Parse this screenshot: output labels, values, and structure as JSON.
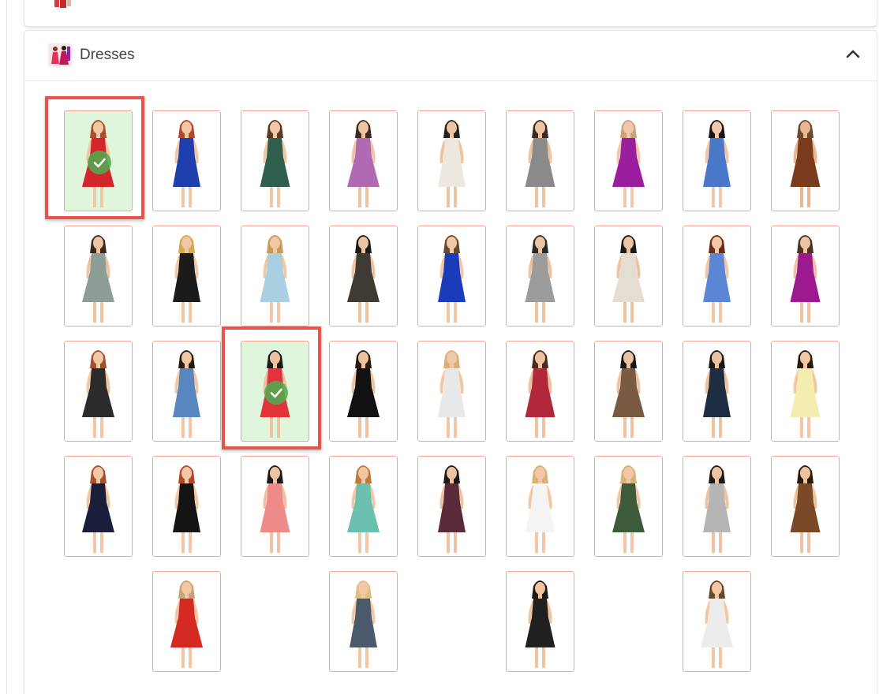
{
  "section": {
    "title": "Dresses",
    "icon": "dresses-category-icon",
    "chevron_icon": "chevron-up-icon"
  },
  "previous_section": {
    "icon": "category-thumbnail-icon"
  },
  "dresses": [
    {
      "dress": "#d3262a",
      "skin": "#f2c7a5",
      "hair": "#a8512c",
      "selected": true
    },
    {
      "dress": "#1f3fb0",
      "skin": "#f2c7a5",
      "hair": "#b4472a",
      "selected": false
    },
    {
      "dress": "#2f5e4c",
      "skin": "#f2c7a5",
      "hair": "#5a3a24",
      "selected": false
    },
    {
      "dress": "#b06ab4",
      "skin": "#eec3a2",
      "hair": "#3b2a20",
      "selected": false
    },
    {
      "dress": "#ece7df",
      "skin": "#eec3a2",
      "hair": "#222222",
      "selected": false
    },
    {
      "dress": "#8a8a8a",
      "skin": "#eec3a2",
      "hair": "#3b2a20",
      "selected": false
    },
    {
      "dress": "#9b1e9e",
      "skin": "#f1c9aa",
      "hair": "#c9a47a",
      "selected": false
    },
    {
      "dress": "#4a78c8",
      "skin": "#f1c9aa",
      "hair": "#151515",
      "selected": false
    },
    {
      "dress": "#7a3b1c",
      "skin": "#e8b690",
      "hair": "#6a4a2c",
      "selected": false
    },
    {
      "dress": "#8d9e96",
      "skin": "#eec3a2",
      "hair": "#3b2a20",
      "selected": false
    },
    {
      "dress": "#1b1b1b",
      "skin": "#f2c7a5",
      "hair": "#d6a84a",
      "selected": false
    },
    {
      "dress": "#a9cfe0",
      "skin": "#f2c7a5",
      "hair": "#c89a5a",
      "selected": false
    },
    {
      "dress": "#3e3a34",
      "skin": "#eec3a2",
      "hair": "#1a1a1a",
      "selected": false
    },
    {
      "dress": "#1a3cba",
      "skin": "#f2c7a5",
      "hair": "#6a4a2c",
      "selected": false
    },
    {
      "dress": "#9c9c9c",
      "skin": "#eec3a2",
      "hair": "#2a2a2a",
      "selected": false
    },
    {
      "dress": "#e4ddd2",
      "skin": "#eec3a2",
      "hair": "#1a1a1a",
      "selected": false
    },
    {
      "dress": "#5b86d6",
      "skin": "#f2c7a5",
      "hair": "#6a2a1a",
      "selected": false
    },
    {
      "dress": "#9c1a8e",
      "skin": "#eec3a2",
      "hair": "#4a3322",
      "selected": false
    },
    {
      "dress": "#2b2b2b",
      "skin": "#f2c7a5",
      "hair": "#a0522d",
      "selected": false
    },
    {
      "dress": "#5a86c0",
      "skin": "#f2c7a5",
      "hair": "#2a1a10",
      "selected": false
    },
    {
      "dress": "#e0343a",
      "skin": "#eec3a2",
      "hair": "#1a1a1a",
      "selected": true
    },
    {
      "dress": "#111111",
      "skin": "#eec3a2",
      "hair": "#2a1a10",
      "selected": false
    },
    {
      "dress": "#e8e8e8",
      "skin": "#f2c7a5",
      "hair": "#d9b27a",
      "selected": false
    },
    {
      "dress": "#b0283a",
      "skin": "#eec3a2",
      "hair": "#4a2a1a",
      "selected": false
    },
    {
      "dress": "#7a5a42",
      "skin": "#eec3a2",
      "hair": "#1a1a1a",
      "selected": false
    },
    {
      "dress": "#1e2e40",
      "skin": "#eec3a2",
      "hair": "#1a1a1a",
      "selected": false
    },
    {
      "dress": "#f3eeb0",
      "skin": "#f2c7a5",
      "hair": "#2a1a10",
      "selected": false
    },
    {
      "dress": "#1a1e3a",
      "skin": "#f2c7a5",
      "hair": "#a8512c",
      "selected": false
    },
    {
      "dress": "#141414",
      "skin": "#f2c7a5",
      "hair": "#b4472a",
      "selected": false
    },
    {
      "dress": "#ee8a8a",
      "skin": "#eec3a2",
      "hair": "#1a1a1a",
      "selected": false
    },
    {
      "dress": "#6cc0b0",
      "skin": "#f2c7a5",
      "hair": "#c07a3a",
      "selected": false
    },
    {
      "dress": "#5a2a3a",
      "skin": "#eec3a2",
      "hair": "#1a1a1a",
      "selected": false
    },
    {
      "dress": "#f4f4f4",
      "skin": "#f2c7a5",
      "hair": "#d9b27a",
      "selected": false
    },
    {
      "dress": "#3d5a3a",
      "skin": "#f2c7a5",
      "hair": "#d9b27a",
      "selected": false
    },
    {
      "dress": "#b5b5b5",
      "skin": "#eec3a2",
      "hair": "#1a1a1a",
      "selected": false
    },
    {
      "dress": "#7a4a28",
      "skin": "#eec3a2",
      "hair": "#2a1a10",
      "selected": false
    },
    {
      "dress": "#d42a22",
      "skin": "#f2c7a5",
      "hair": "#c9a47a",
      "selected": false
    },
    {
      "dress": "#4a5a6a",
      "skin": "#f2c7a5",
      "hair": "#e0c080",
      "selected": false
    },
    {
      "dress": "#202020",
      "skin": "#eec3a2",
      "hair": "#1a1a1a",
      "selected": false
    },
    {
      "dress": "#ececec",
      "skin": "#f2c7a5",
      "hair": "#6a4a2c",
      "selected": false
    }
  ],
  "colors": {
    "tile_border": "#f0a592",
    "selected_frame": "#e8544a",
    "selected_bg": "#dff5dc",
    "check_green": "#4caf50"
  }
}
